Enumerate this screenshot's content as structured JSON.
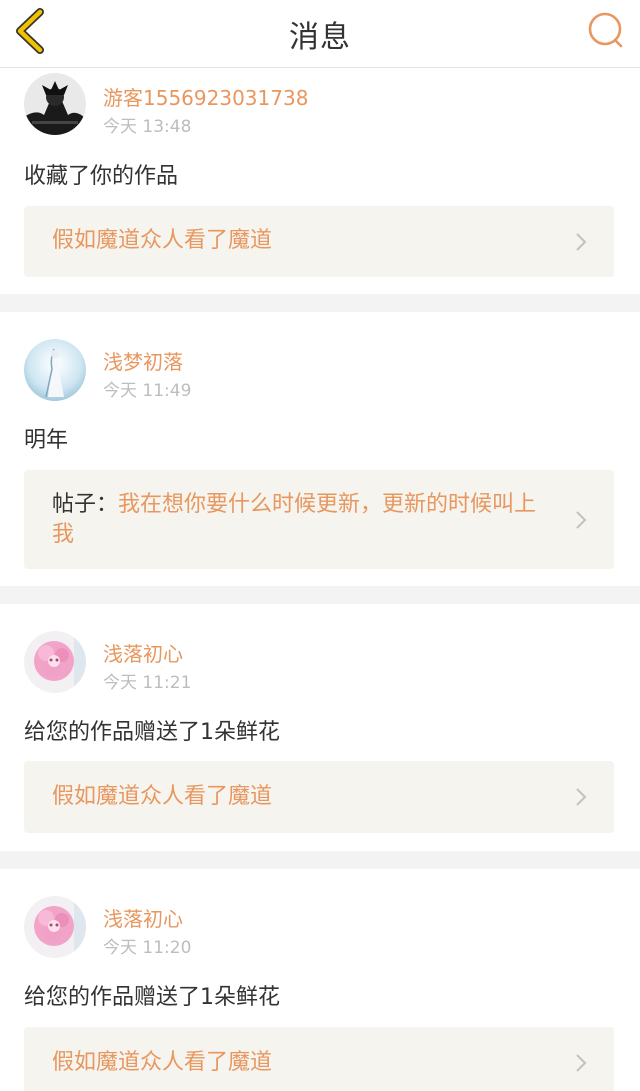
{
  "header": {
    "title": "消息",
    "back_icon": "chevron-left-icon",
    "search_icon": "search-icon",
    "accent_color": "#e8975f",
    "back_color": "#e0b000"
  },
  "messages": [
    {
      "username": "游客1556923031738",
      "time": "今天 13:48",
      "action": "收藏了你的作品",
      "link_prefix": "",
      "link_text": "假如魔道众人看了魔道"
    },
    {
      "username": "浅梦初落",
      "time": "今天 11:49",
      "action": "明年",
      "link_prefix": "帖子：",
      "link_text": "我在想你要什么时候更新，更新的时候叫上我"
    },
    {
      "username": "浅落初心",
      "time": "今天 11:21",
      "action": "给您的作品赠送了1朵鲜花",
      "link_prefix": "",
      "link_text": "假如魔道众人看了魔道"
    },
    {
      "username": "浅落初心",
      "time": "今天 11:20",
      "action": "给您的作品赠送了1朵鲜花",
      "link_prefix": "",
      "link_text": "假如魔道众人看了魔道"
    }
  ]
}
